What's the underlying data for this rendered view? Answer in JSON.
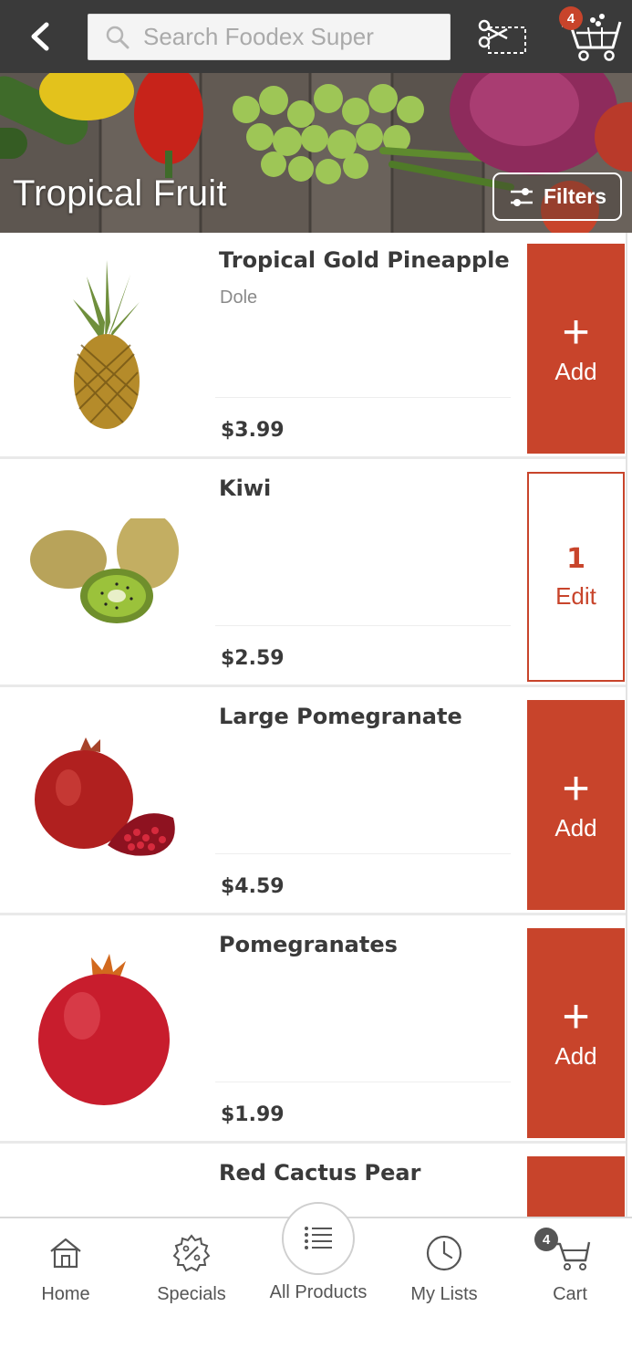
{
  "topbar": {
    "search_placeholder": "Search Foodex Super",
    "cart_count": "4"
  },
  "hero": {
    "title": "Tropical Fruit",
    "filters_label": "Filters"
  },
  "products": [
    {
      "name": "Tropical Gold Pineapple",
      "brand": "Dole",
      "price": "$3.99",
      "action": "add",
      "action_icon": "+",
      "action_label": "Add"
    },
    {
      "name": "Kiwi",
      "brand": "",
      "price": "$2.59",
      "action": "edit",
      "quantity": "1",
      "action_label": "Edit"
    },
    {
      "name": "Large Pomegranate",
      "brand": "",
      "price": "$4.59",
      "action": "add",
      "action_icon": "+",
      "action_label": "Add"
    },
    {
      "name": "Pomegranates",
      "brand": "",
      "price": "$1.99",
      "action": "add",
      "action_icon": "+",
      "action_label": "Add"
    },
    {
      "name": "Red Cactus Pear",
      "brand": "",
      "price": "",
      "action": "add",
      "action_icon": "",
      "action_label": ""
    }
  ],
  "bottom_nav": {
    "items": [
      {
        "label": "Home",
        "icon": "home-icon"
      },
      {
        "label": "Specials",
        "icon": "specials-badge-icon"
      },
      {
        "label": "All Products",
        "icon": "list-icon"
      },
      {
        "label": "My Lists",
        "icon": "clock-icon"
      },
      {
        "label": "Cart",
        "icon": "cart-icon"
      }
    ],
    "cart_count": "4"
  },
  "colors": {
    "topbar": "#3a3a3a",
    "accent": "#c8442b",
    "text": "#3a3a3a",
    "muted": "#8a8a8a"
  }
}
